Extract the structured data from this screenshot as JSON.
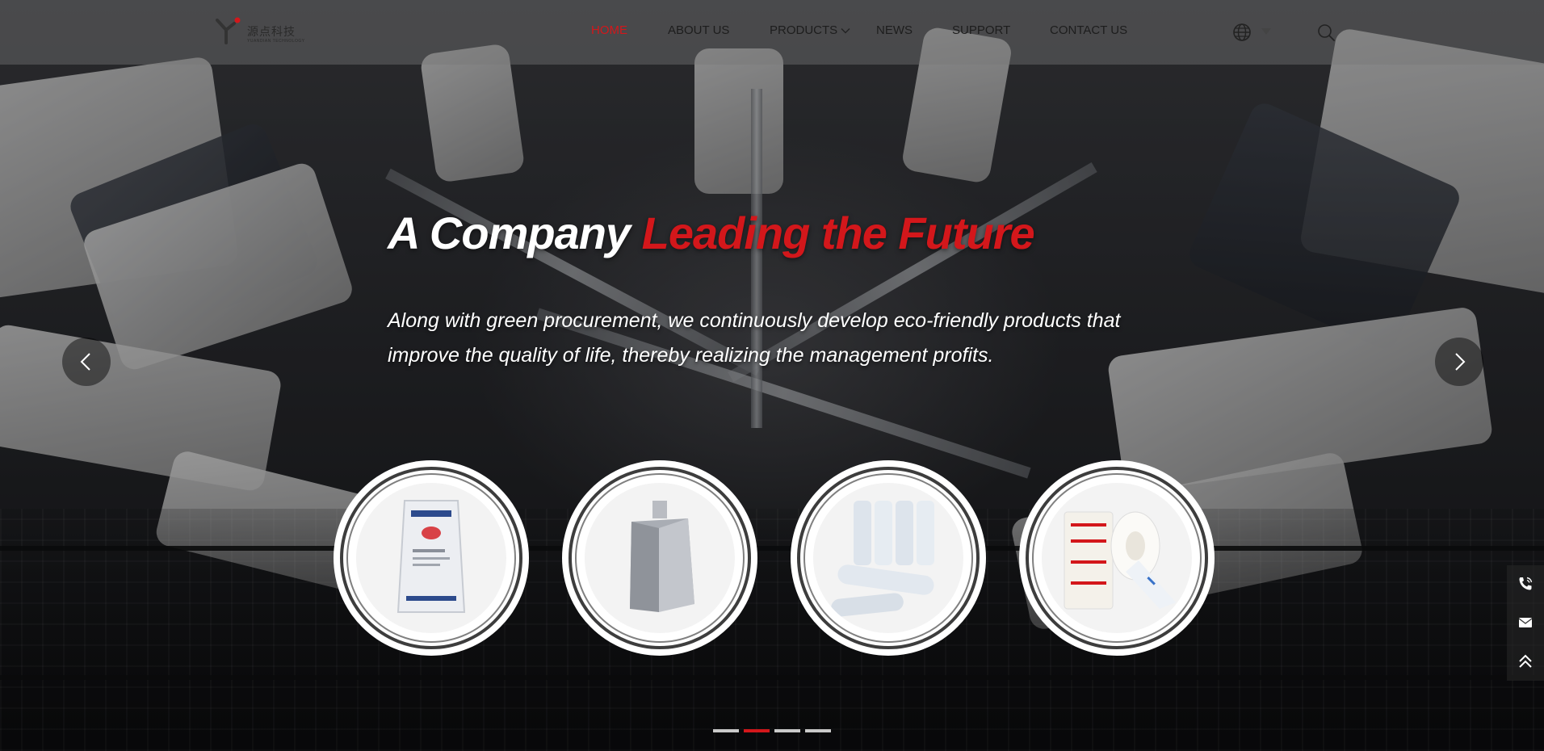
{
  "brand": {
    "name_cn": "源点科技",
    "name_en": "YUANDIAN TECHNOLOGY",
    "accent_color": "#d3171b"
  },
  "nav": {
    "items": [
      {
        "label": "HOME",
        "active": true
      },
      {
        "label": "ABOUT US",
        "active": false
      },
      {
        "label": "PRODUCTS",
        "active": false,
        "has_dropdown": true
      },
      {
        "label": "NEWS",
        "active": false
      },
      {
        "label": "SUPPORT",
        "active": false
      },
      {
        "label": "CONTACT US",
        "active": false
      }
    ],
    "language_icon": "globe-icon",
    "search_icon": "search-icon"
  },
  "hero": {
    "headline_white": "A Company",
    "headline_red": "Leading the Future",
    "subtext_line1": "Along with green procurement, we continuously develop eco-friendly products that",
    "subtext_line2": "improve the quality of life, thereby realizing the management profits."
  },
  "carousel": {
    "prev_icon": "chevron-left-icon",
    "next_icon": "chevron-right-icon",
    "slide_count": 4,
    "active_slide": 2
  },
  "products": [
    {
      "icon": "resin-bag-icon"
    },
    {
      "icon": "aluminum-bulk-bag-icon"
    },
    {
      "icon": "stretch-film-rolls-icon"
    },
    {
      "icon": "printed-label-rolls-icon"
    }
  ],
  "side_bar": {
    "phone_icon": "phone-icon",
    "mail_icon": "mail-icon",
    "top_icon": "back-to-top-icon"
  }
}
